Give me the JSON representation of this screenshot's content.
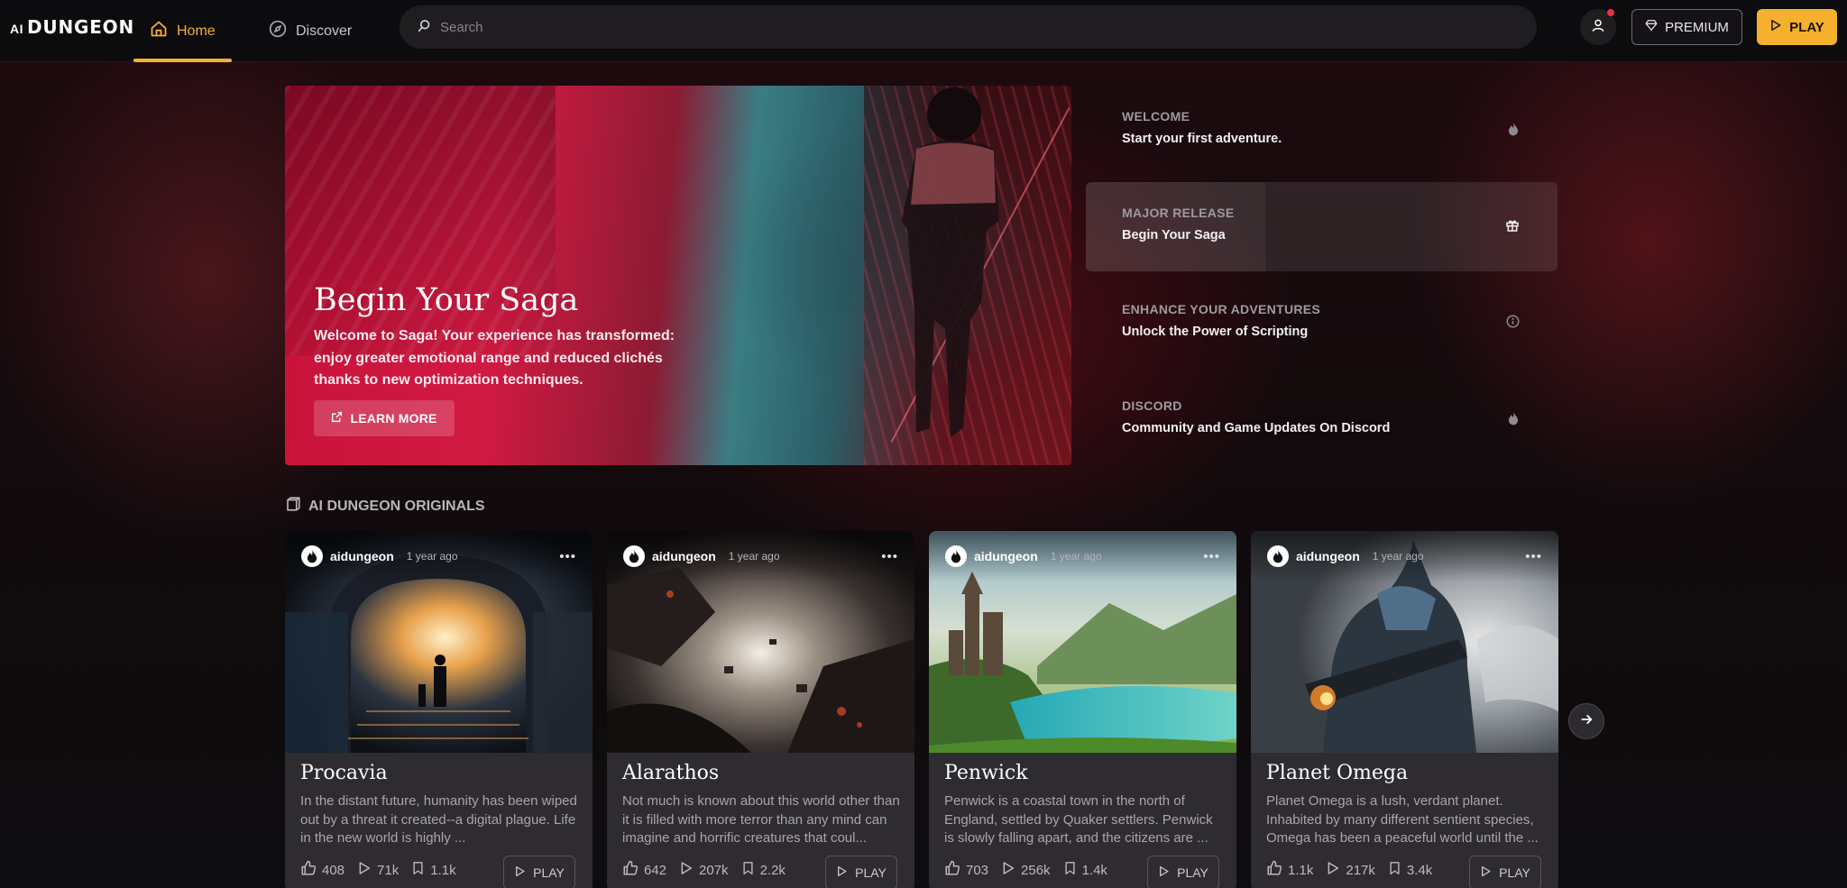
{
  "header": {
    "logo_ai": "AI",
    "logo_name": "DUNGEON",
    "nav": [
      {
        "label": "Home",
        "icon": "home-icon",
        "active": true
      },
      {
        "label": "Discover",
        "icon": "compass-icon",
        "active": false
      }
    ],
    "search": {
      "placeholder": "Search",
      "value": ""
    },
    "premium_label": "PREMIUM",
    "play_label": "PLAY",
    "accent": "#f5b02e"
  },
  "hero": {
    "title": "Begin Your Saga",
    "description": "Welcome to Saga! Your experience has transformed: enjoy greater emotional range and reduced clichés thanks to new optimization techniques.",
    "button_label": "LEARN MORE"
  },
  "news": [
    {
      "category": "WELCOME",
      "title": "Start your first adventure.",
      "icon": "flame-icon"
    },
    {
      "category": "MAJOR RELEASE",
      "title": "Begin Your Saga",
      "icon": "gift-icon",
      "active": true
    },
    {
      "category": "ENHANCE YOUR ADVENTURES",
      "title": "Unlock the Power of Scripting",
      "icon": "info-icon"
    },
    {
      "category": "DISCORD",
      "title": "Community and Game Updates On Discord",
      "icon": "flame-icon"
    }
  ],
  "originals": {
    "heading": "AI DUNGEON ORIGINALS",
    "cards": [
      {
        "author": "aidungeon",
        "age": "1 year ago",
        "title": "Procavia",
        "description": "In the distant future, humanity has been wiped out by a threat it created--a digital plague. Life in the new world is highly ...",
        "likes": "408",
        "plays": "71k",
        "saves": "1.1k",
        "play_label": "PLAY"
      },
      {
        "author": "aidungeon",
        "age": "1 year ago",
        "title": "Alarathos",
        "description": "Not much is known about this world other than it is filled with more terror than any mind can imagine and horrific creatures that coul...",
        "likes": "642",
        "plays": "207k",
        "saves": "2.2k",
        "play_label": "PLAY"
      },
      {
        "author": "aidungeon",
        "age": "1 year ago",
        "title": "Penwick",
        "description": "Penwick is a coastal town in the north of England, settled by Quaker settlers. Penwick is slowly falling apart, and the citizens are ...",
        "likes": "703",
        "plays": "256k",
        "saves": "1.4k",
        "play_label": "PLAY"
      },
      {
        "author": "aidungeon",
        "age": "1 year ago",
        "title": "Planet Omega",
        "description": "Planet Omega is a lush, verdant planet. Inhabited by many different sentient species, Omega has been a peaceful world until the ...",
        "likes": "1.1k",
        "plays": "217k",
        "saves": "3.4k",
        "play_label": "PLAY"
      }
    ]
  }
}
